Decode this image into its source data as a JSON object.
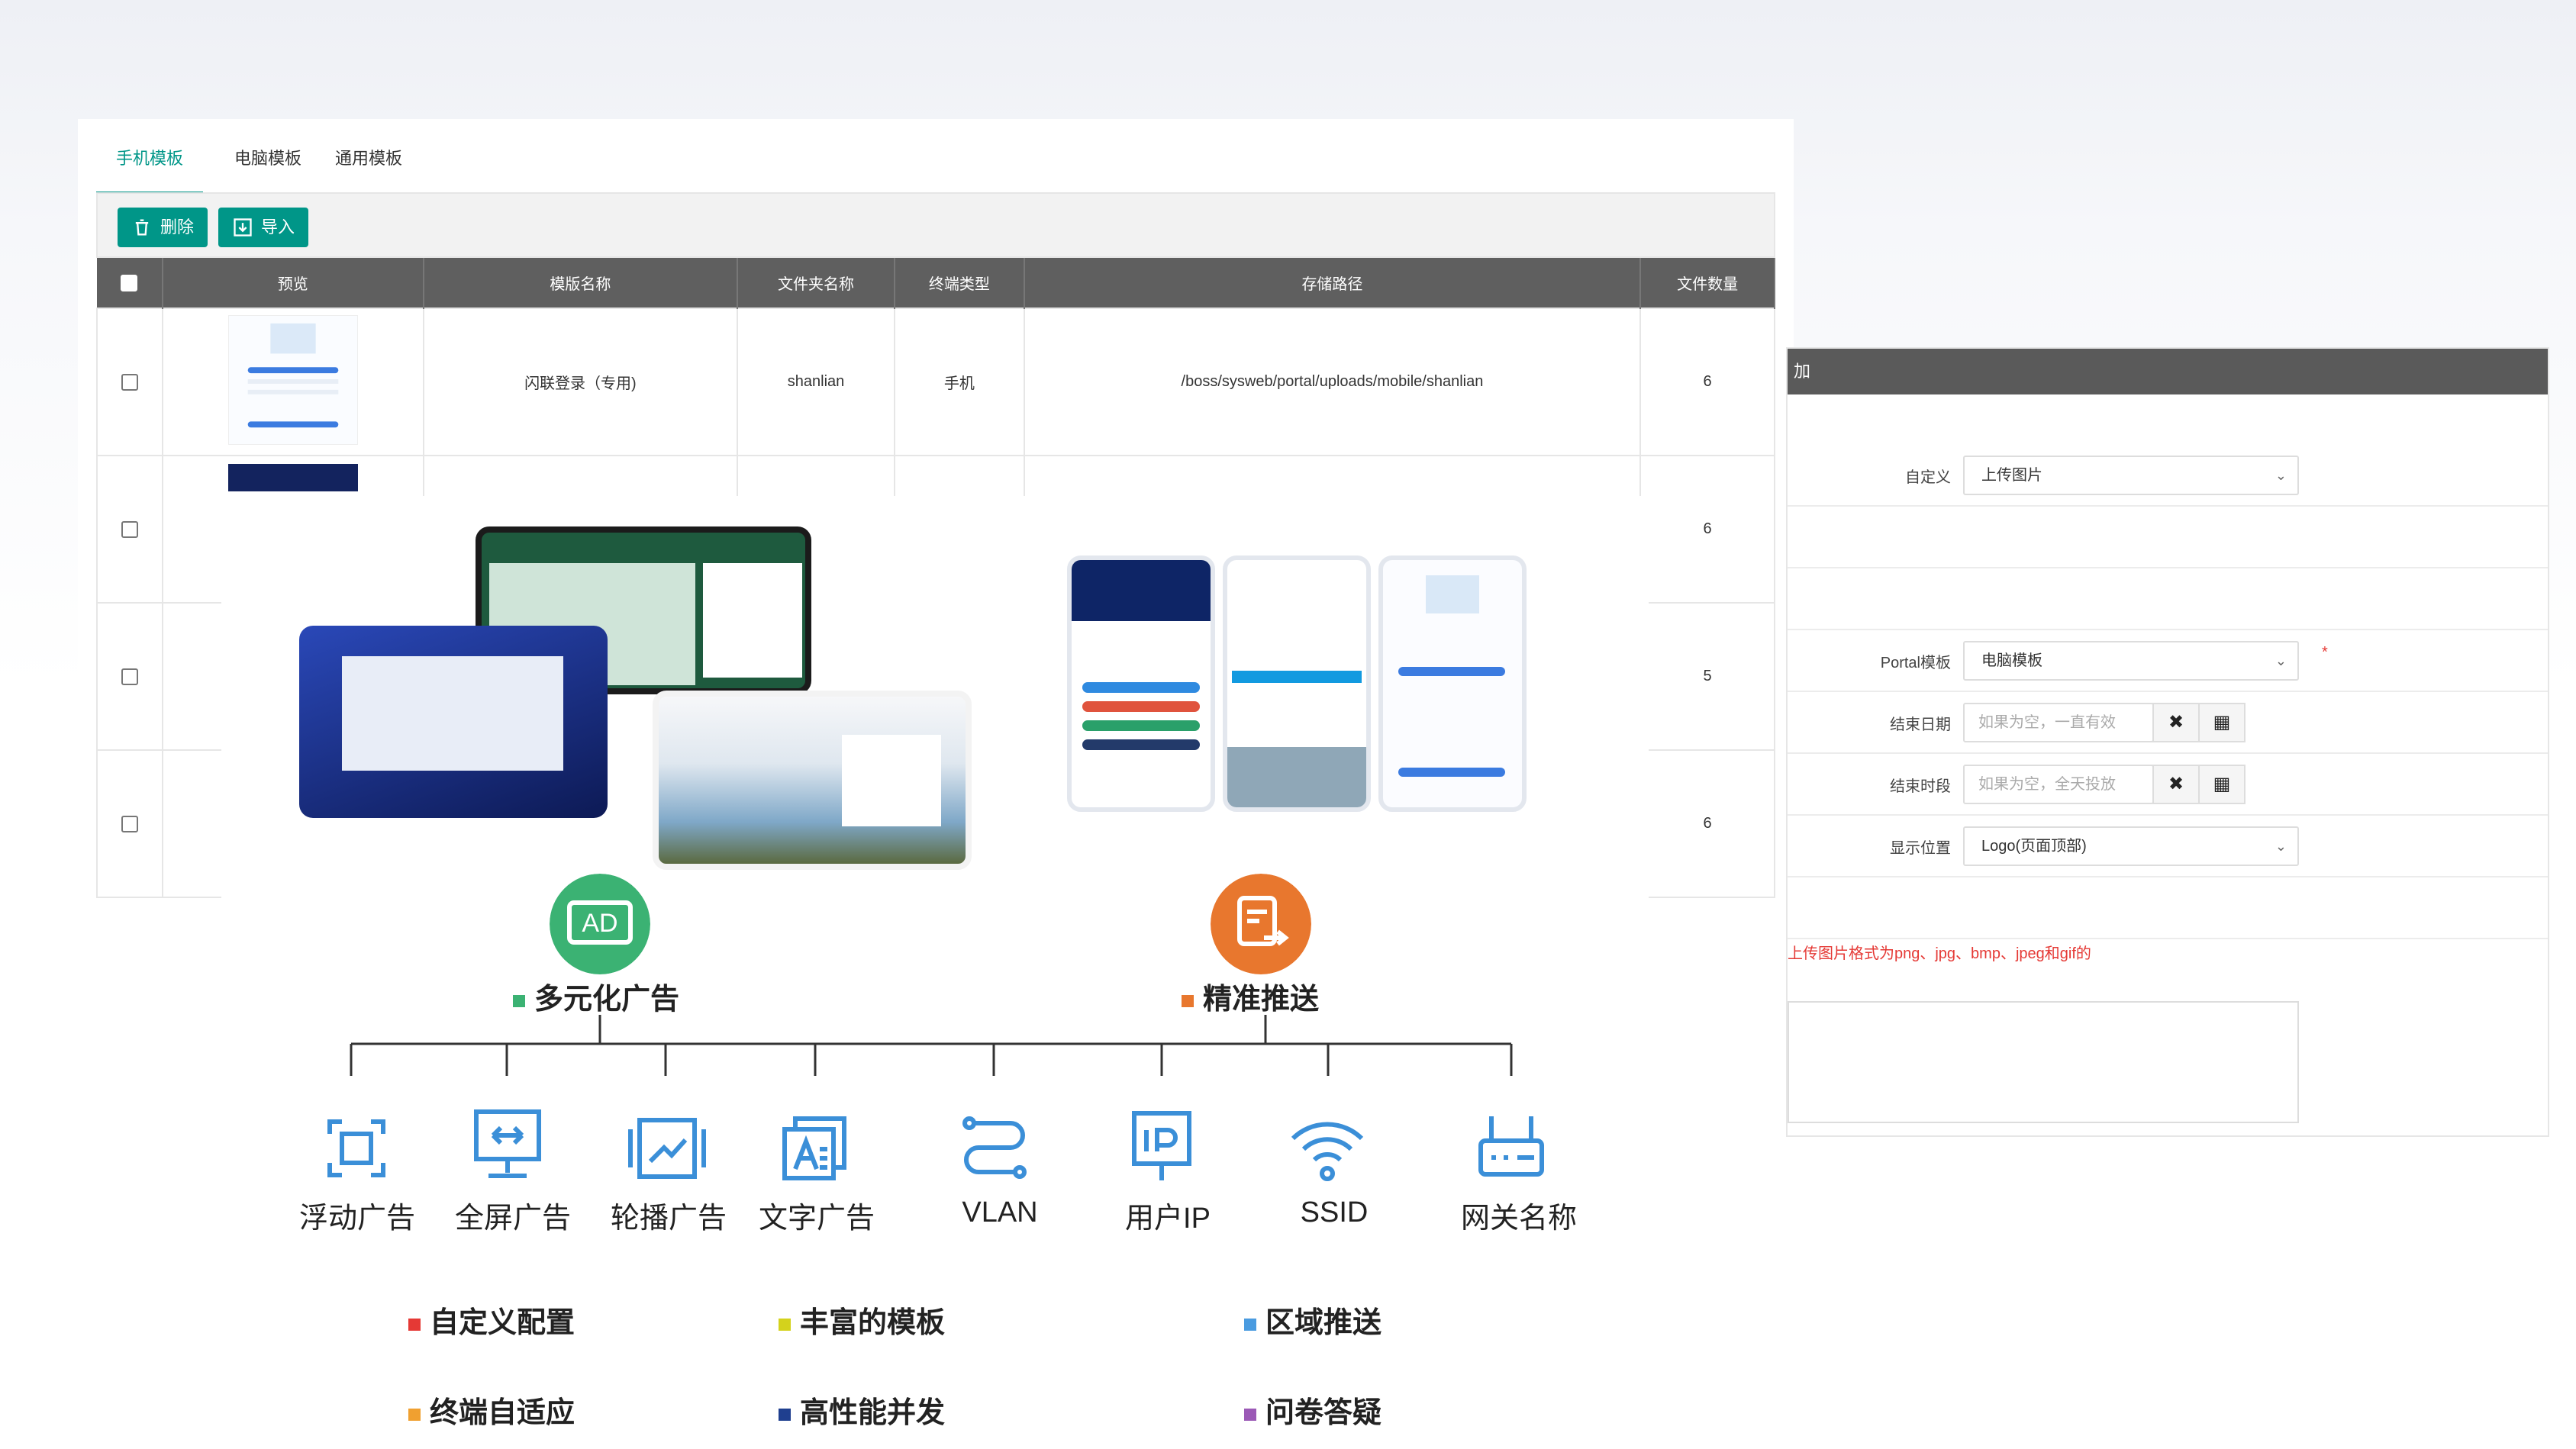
{
  "template_manager": {
    "tabs": [
      {
        "label": "手机模板",
        "active": true
      },
      {
        "label": "电脑模板",
        "active": false
      },
      {
        "label": "通用模板",
        "active": false
      }
    ],
    "toolbar": {
      "delete_label": "删除",
      "import_label": "导入"
    },
    "columns": [
      "预览",
      "模版名称",
      "文件夹名称",
      "终端类型",
      "存储路径",
      "文件数量"
    ],
    "rows": [
      {
        "name": "闪联登录（专用)",
        "folder": "shanlian",
        "terminal": "手机",
        "path": "/boss/sysweb/portal/uploads/mobile/shanlian",
        "count": "6"
      },
      {
        "name": "",
        "folder": "",
        "terminal": "",
        "path": "",
        "count": "6"
      },
      {
        "name": "",
        "folder": "",
        "terminal": "",
        "path": "",
        "count": "5"
      },
      {
        "name": "",
        "folder": "",
        "terminal": "",
        "path": "",
        "count": "6"
      }
    ],
    "accent": "#009688"
  },
  "ad_form": {
    "header_fragment": "加",
    "fields": {
      "custom_label": "自定义",
      "custom_value": "上传图片",
      "portal_label": "Portal模板",
      "portal_value": "电脑模板",
      "required_mark": "*",
      "end_date_label": "结束日期",
      "end_date_placeholder": "如果为空，一直有效",
      "end_period_label": "结束时段",
      "end_period_placeholder": "如果为空，全天投放",
      "position_label": "显示位置",
      "position_value": "Logo(页面顶部)"
    },
    "upload_hint": "上传图片格式为png、jpg、bmp、jpeg和gif的"
  },
  "illustration": {
    "left_feature": {
      "title": "多元化广告",
      "icon_text": "AD",
      "color": "#3bb273"
    },
    "right_feature": {
      "title": "精准推送",
      "color": "#e8772e"
    },
    "ad_items": [
      "浮动广告",
      "全屏广告",
      "轮播广告",
      "文字广告"
    ],
    "push_items": [
      "VLAN",
      "用户IP",
      "SSID",
      "网关名称"
    ],
    "tags": [
      {
        "label": "自定义配置",
        "color": "#e53935"
      },
      {
        "label": "丰富的模板",
        "color": "#d4d21c"
      },
      {
        "label": "区域推送",
        "color": "#4a9be0"
      },
      {
        "label": "终端自适应",
        "color": "#f0a030"
      },
      {
        "label": "高性能并发",
        "color": "#1f3f8f"
      },
      {
        "label": "问卷答疑",
        "color": "#9b59b6"
      }
    ],
    "icon_color": "#3b8fd8"
  }
}
